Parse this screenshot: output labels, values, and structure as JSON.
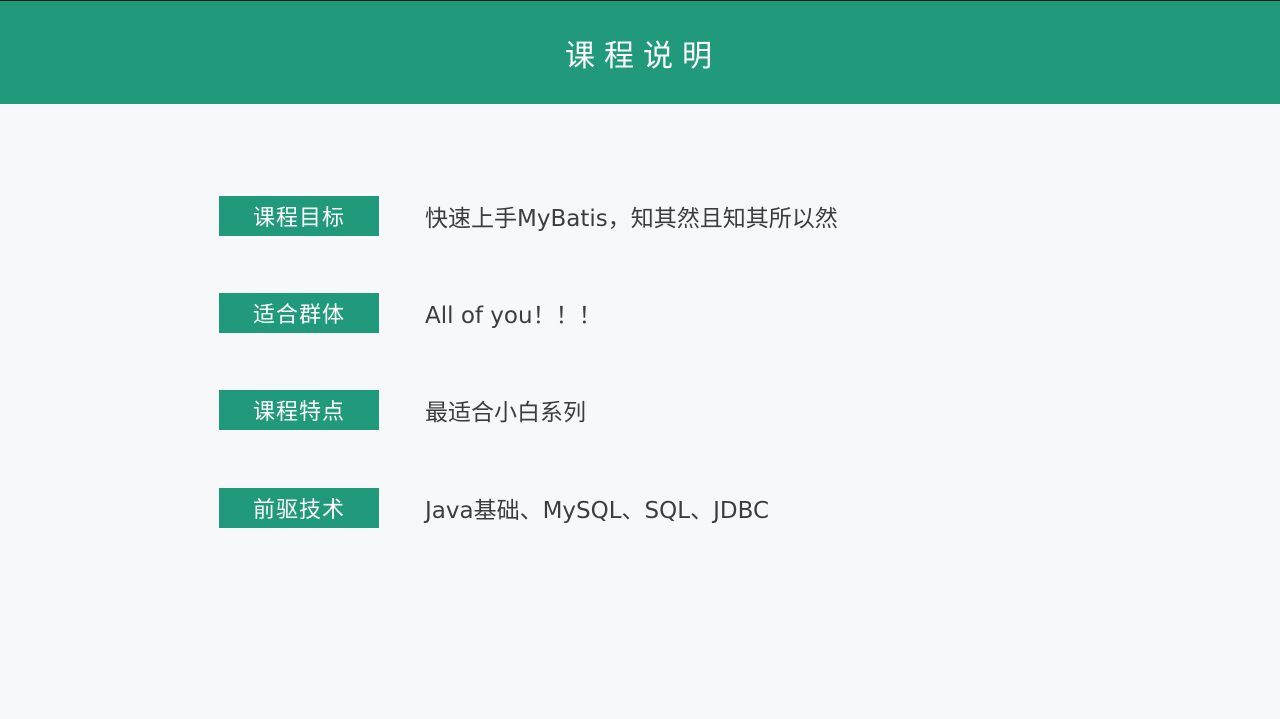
{
  "header": {
    "title": "课程说明"
  },
  "items": [
    {
      "label": "课程目标",
      "value": "快速上手MyBatis，知其然且知其所以然"
    },
    {
      "label": "适合群体",
      "value": "All of you！！！"
    },
    {
      "label": "课程特点",
      "value": "最适合小白系列"
    },
    {
      "label": "前驱技术",
      "value": "Java基础、MySQL、SQL、JDBC"
    }
  ],
  "colors": {
    "accent": "#209a7b",
    "background": "#f6f8fa",
    "text": "#3d3d3d"
  }
}
